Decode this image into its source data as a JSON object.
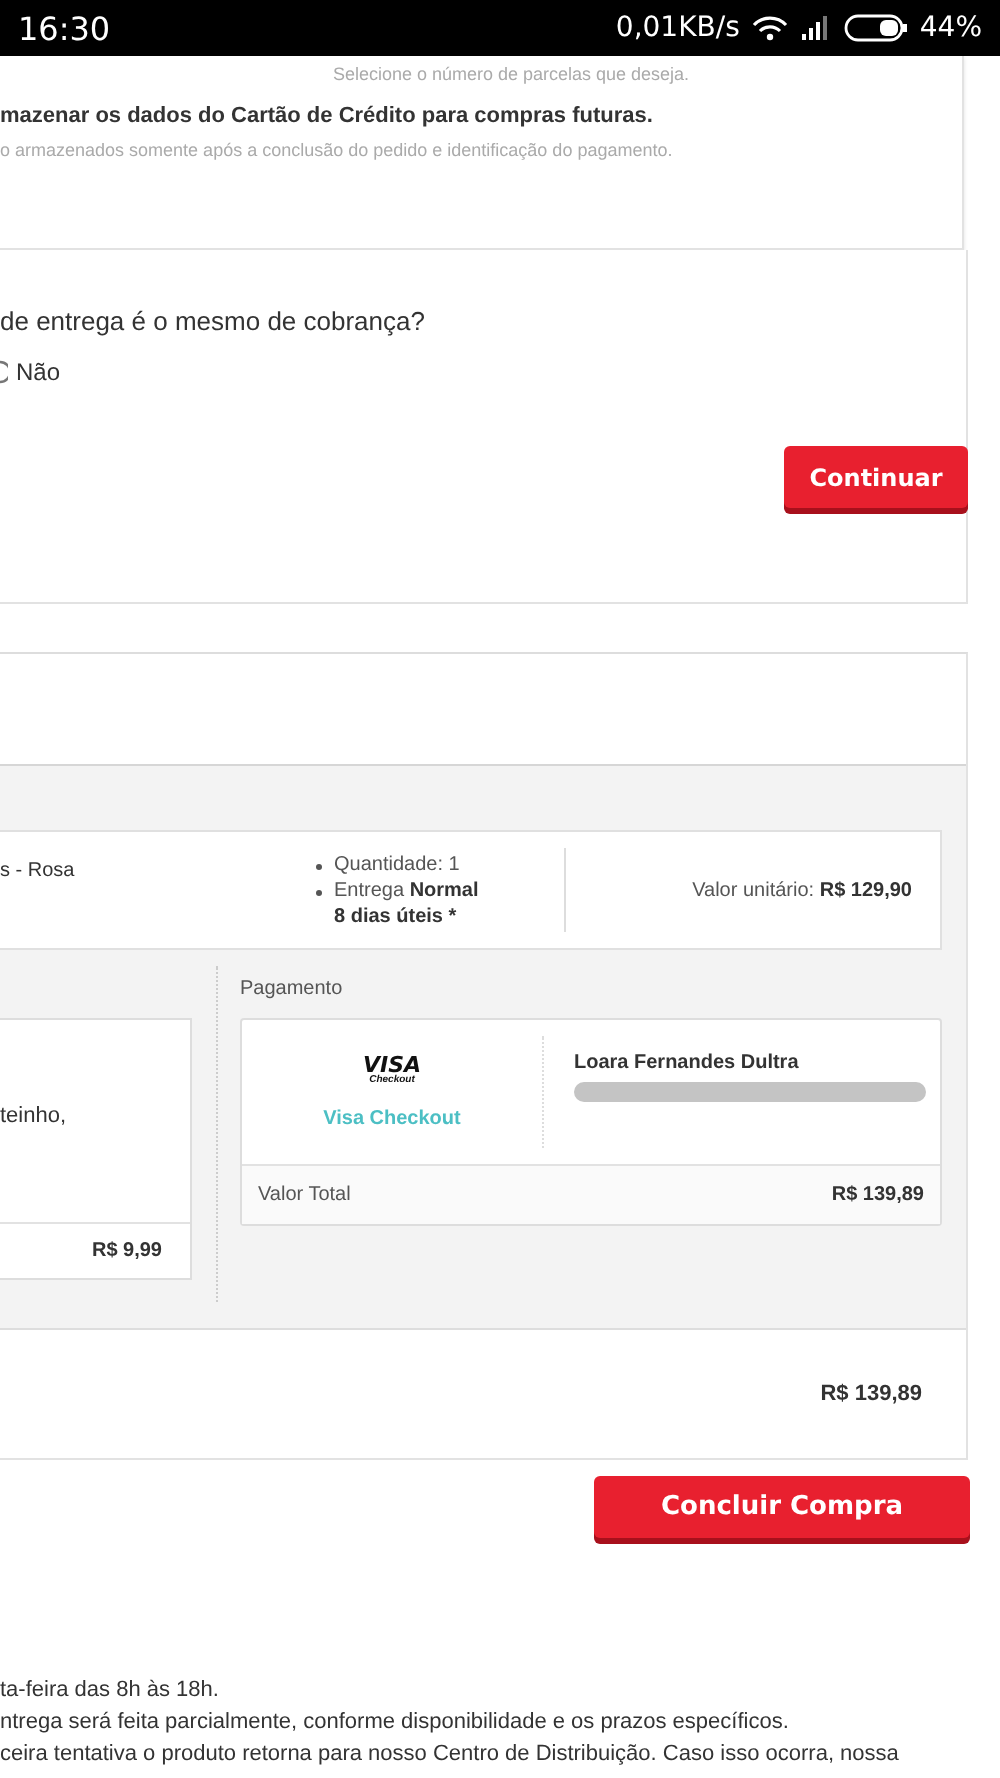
{
  "status_bar": {
    "time": "16:30",
    "network_speed": "0,01KB/s",
    "battery": "44%"
  },
  "installments_card": {
    "hint": "Selecione o número de parcelas que deseja.",
    "save_card_label": "mazenar os dados do Cartão de Crédito para compras futuras.",
    "save_card_note": "o armazenados somente após a conclusão do pedido e identificação do pagamento."
  },
  "address_question": {
    "question": "de entrega é o mesmo de cobrança?",
    "option": "Não"
  },
  "continue_button": "Continuar",
  "order": {
    "item": {
      "name": "s - Rosa",
      "details": [
        {
          "text": "Quantidade: 1"
        },
        {
          "text": "Entrega **Normal**",
          "subtext": "8 dias úteis *"
        }
      ],
      "unit_price": "Valor unitário: **R$ 129,90**"
    },
    "shipping": {
      "address": "teinho,",
      "price": "R$ 9,99"
    },
    "payment": {
      "heading": "Pagamento",
      "logo_text": "VISA",
      "logo_subtext": "Checkout",
      "method": "Visa Checkout",
      "holder": "Loara Fernandes Dultra",
      "total_label": "Valor Total",
      "total": "R$ 139,89"
    },
    "grand_total": "R$ 139,89"
  },
  "finish_button": "Concluir Compra",
  "notes": [
    "ta-feira das 8h às 18h.",
    "ntrega será feita parcialmente, conforme disponibilidade e os prazos específicos.",
    "ceira tentativa o produto retorna para nosso Centro de Distribuição. Caso isso ocorra, nossa"
  ]
}
